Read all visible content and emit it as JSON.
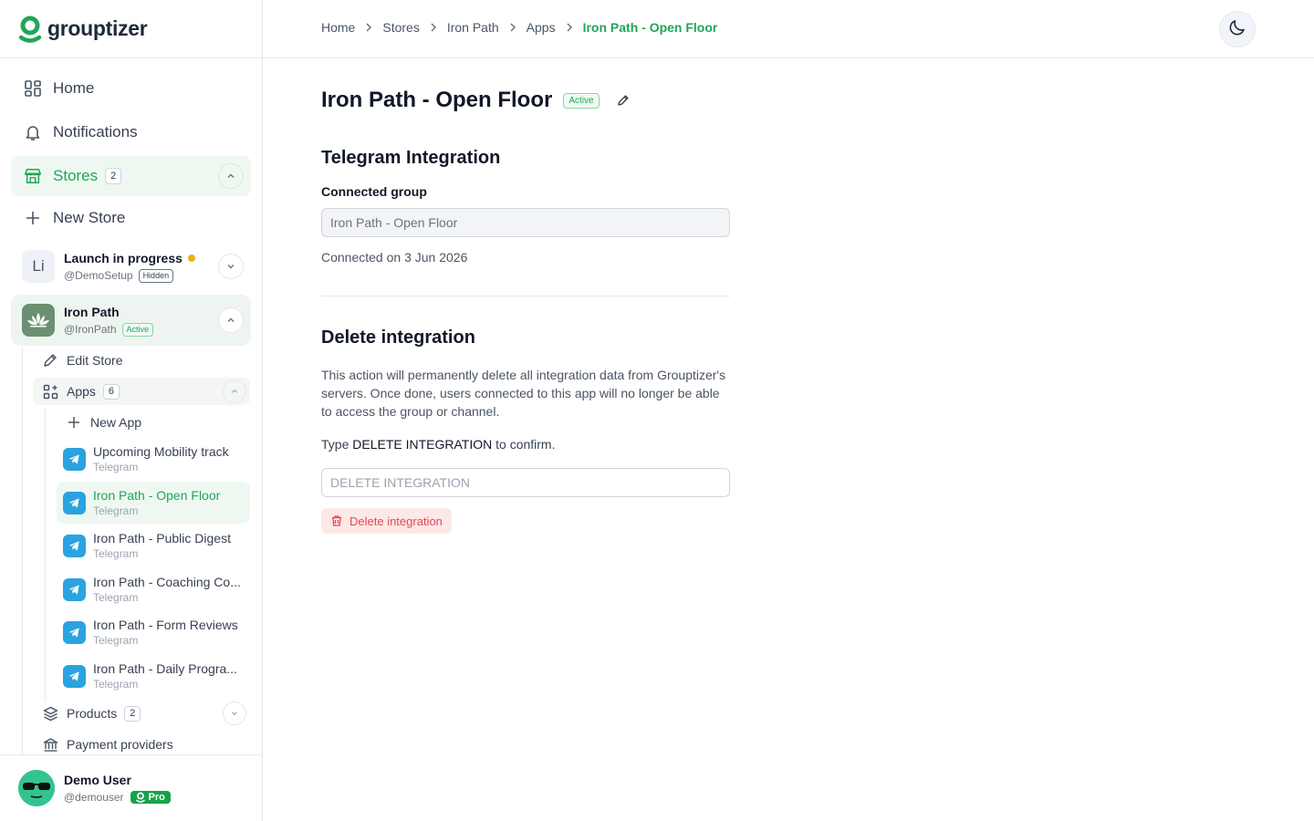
{
  "brand": {
    "name": "grouptizer",
    "accent": "#22a559"
  },
  "sidebar": {
    "nav": [
      {
        "label": "Home",
        "icon": "dashboard-icon"
      },
      {
        "label": "Notifications",
        "icon": "bell-icon"
      },
      {
        "label": "Stores",
        "icon": "store-icon",
        "count": "2"
      },
      {
        "label": "New Store",
        "icon": "plus-icon"
      }
    ],
    "stores": [
      {
        "initials": "Li",
        "name": "Launch in progress",
        "handle": "@DemoSetup",
        "tag": "Hidden"
      },
      {
        "name": "Iron Path",
        "handle": "@IronPath",
        "tag": "Active"
      }
    ],
    "store_menu": {
      "edit": "Edit Store",
      "apps": "Apps",
      "apps_count": "6",
      "new_app": "New App",
      "products": "Products",
      "products_count": "2",
      "payment": "Payment providers"
    },
    "apps": [
      {
        "name": "Upcoming Mobility track",
        "type": "Telegram"
      },
      {
        "name": "Iron Path - Open Floor",
        "type": "Telegram"
      },
      {
        "name": "Iron Path - Public Digest",
        "type": "Telegram"
      },
      {
        "name": "Iron Path - Coaching Co...",
        "type": "Telegram"
      },
      {
        "name": "Iron Path - Form Reviews",
        "type": "Telegram"
      },
      {
        "name": "Iron Path - Daily Progra...",
        "type": "Telegram"
      }
    ],
    "user": {
      "name": "Demo User",
      "handle": "@demouser",
      "plan": "Pro"
    }
  },
  "header": {
    "breadcrumb": [
      "Home",
      "Stores",
      "Iron Path",
      "Apps",
      "Iron Path - Open Floor"
    ]
  },
  "main": {
    "title": "Iron Path - Open Floor",
    "status": "Active",
    "telegram": {
      "heading": "Telegram Integration",
      "group_label": "Connected group",
      "group_value": "Iron Path - Open Floor",
      "connected": "Connected on 3 Jun 2026"
    },
    "delete": {
      "heading": "Delete integration",
      "description": "This action will permanently delete all integration data from Grouptizer's servers. Once done, users connected to this app will no longer be able to access the group or channel.",
      "confirm_prefix": "Type ",
      "confirm_code": "DELETE INTEGRATION",
      "confirm_suffix": " to confirm.",
      "placeholder": "DELETE INTEGRATION",
      "button": "Delete integration"
    }
  }
}
